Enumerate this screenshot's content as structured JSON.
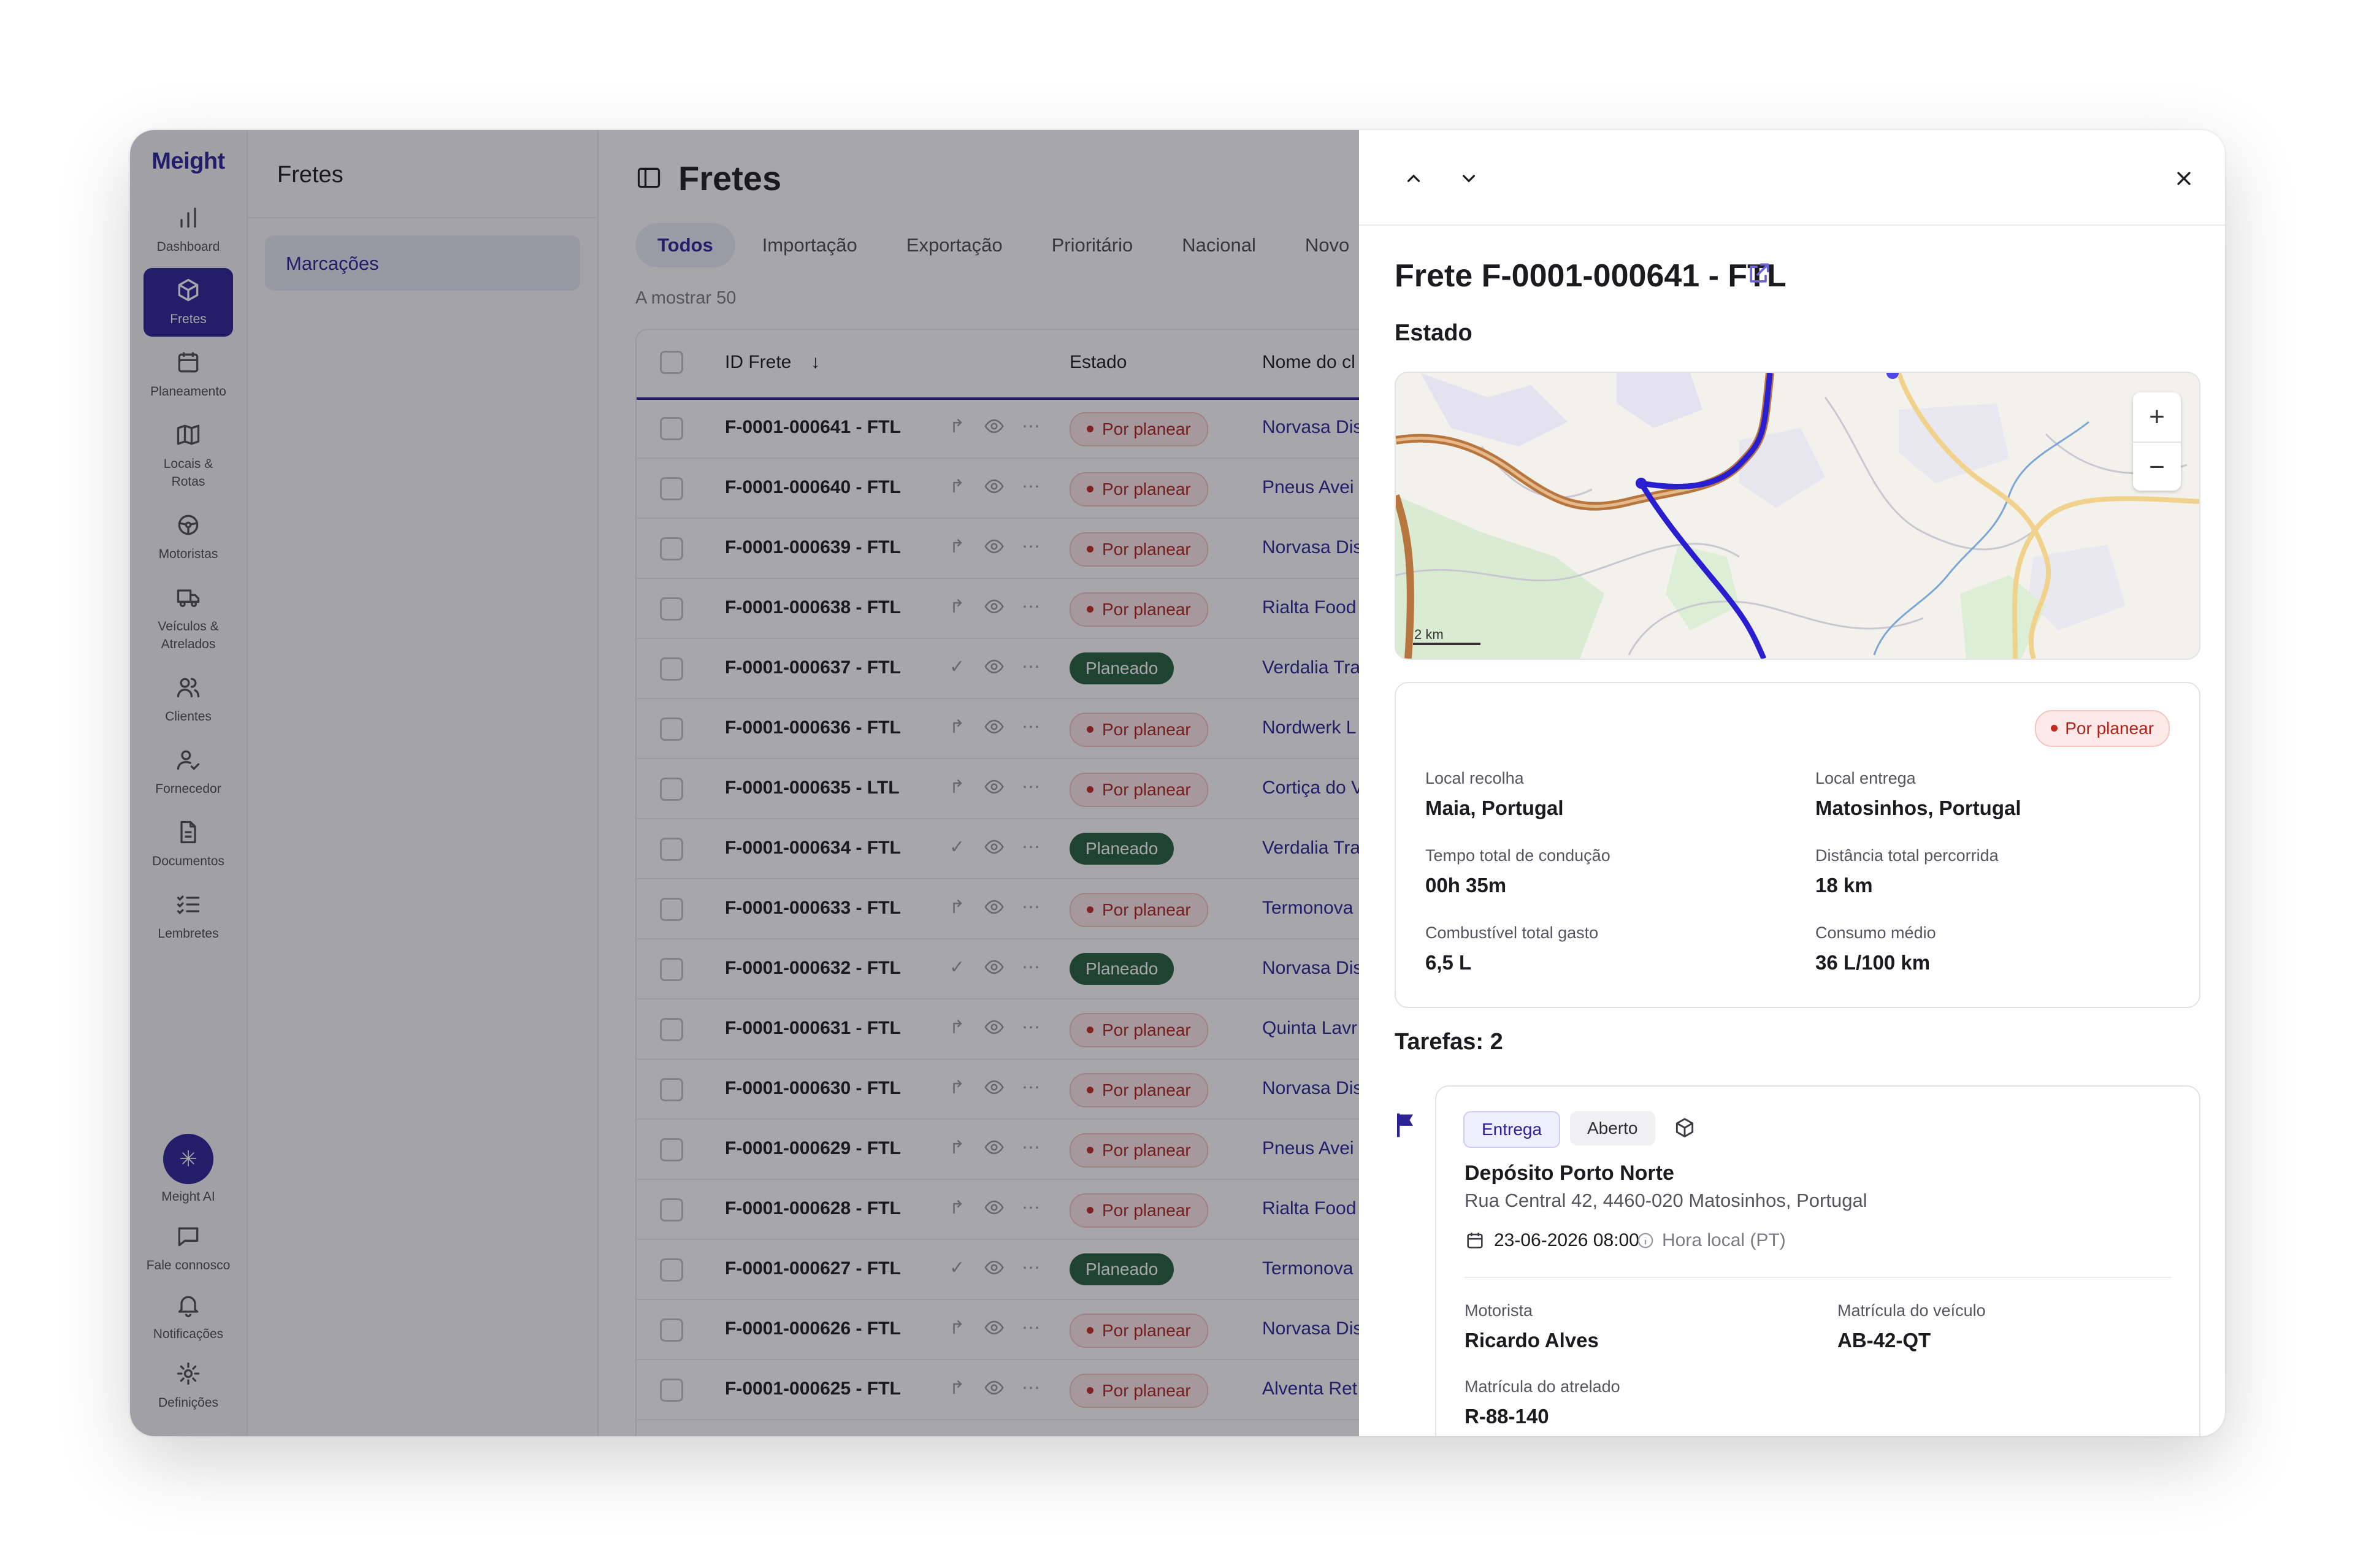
{
  "brand": "Meight",
  "nav": {
    "dashboard": "Dashboard",
    "fretes": "Fretes",
    "planeamento": "Planeamento",
    "locais": "Locais & Rotas",
    "motoristas": "Motoristas",
    "veiculos": "Veículos & Atrelados",
    "clientes": "Clientes",
    "fornecedor": "Fornecedor",
    "documentos": "Documentos",
    "lembretes": "Lembretes",
    "ai": "Meight AI",
    "contact": "Fale connosco",
    "notifications": "Notificações",
    "settings": "Definições"
  },
  "subnav": {
    "title": "Fretes",
    "item": "Marcações"
  },
  "main": {
    "title": "Fretes",
    "tabs": [
      "Todos",
      "Importação",
      "Exportação",
      "Prioritário",
      "Nacional",
      "Novo"
    ],
    "showing": "A mostrar 50",
    "col_id": "ID Frete",
    "col_status": "Estado",
    "col_client": "Nome do cl"
  },
  "rows": [
    {
      "id": "F-0001-000641 - FTL",
      "status": "Por planear",
      "state": "red",
      "client": "Norvasa Dis"
    },
    {
      "id": "F-0001-000640 - FTL",
      "status": "Por planear",
      "state": "red",
      "client": "Pneus Avei"
    },
    {
      "id": "F-0001-000639 - FTL",
      "status": "Por planear",
      "state": "red",
      "client": "Norvasa Dis"
    },
    {
      "id": "F-0001-000638 - FTL",
      "status": "Por planear",
      "state": "red",
      "client": "Rialta Food"
    },
    {
      "id": "F-0001-000637 - FTL",
      "status": "Planeado",
      "state": "green",
      "client": "Verdalia Tra"
    },
    {
      "id": "F-0001-000636 - FTL",
      "status": "Por planear",
      "state": "red",
      "client": "Nordwerk L"
    },
    {
      "id": "F-0001-000635 - LTL",
      "status": "Por planear",
      "state": "red",
      "client": "Cortiça do V"
    },
    {
      "id": "F-0001-000634 - FTL",
      "status": "Planeado",
      "state": "green",
      "client": "Verdalia Tra"
    },
    {
      "id": "F-0001-000633 - FTL",
      "status": "Por planear",
      "state": "red",
      "client": "Termonova"
    },
    {
      "id": "F-0001-000632 - FTL",
      "status": "Planeado",
      "state": "green",
      "client": "Norvasa Dis"
    },
    {
      "id": "F-0001-000631 - FTL",
      "status": "Por planear",
      "state": "red",
      "client": "Quinta Lavr"
    },
    {
      "id": "F-0001-000630 - FTL",
      "status": "Por planear",
      "state": "red",
      "client": "Norvasa Dis"
    },
    {
      "id": "F-0001-000629 - FTL",
      "status": "Por planear",
      "state": "red",
      "client": "Pneus Avei"
    },
    {
      "id": "F-0001-000628 - FTL",
      "status": "Por planear",
      "state": "red",
      "client": "Rialta Food"
    },
    {
      "id": "F-0001-000627 - FTL",
      "status": "Planeado",
      "state": "green",
      "client": "Termonova"
    },
    {
      "id": "F-0001-000626 - FTL",
      "status": "Por planear",
      "state": "red",
      "client": "Norvasa Dis"
    },
    {
      "id": "F-0001-000625 - FTL",
      "status": "Por planear",
      "state": "red",
      "client": "Alventa Ret"
    }
  ],
  "detail": {
    "title": "Frete F-0001-000641 - FTL",
    "estado_label": "Estado",
    "map_scale": "2 km",
    "status_badge": "Por planear",
    "pickup_label": "Local recolha",
    "pickup": "Maia, Portugal",
    "delivery_label": "Local entrega",
    "delivery": "Matosinhos, Portugal",
    "drive_time_label": "Tempo total de condução",
    "drive_time": "00h 35m",
    "distance_label": "Distância total percorrida",
    "distance": "18 km",
    "fuel_label": "Combustível total gasto",
    "fuel": "6,5 L",
    "consumption_label": "Consumo médio",
    "consumption": "36 L/100 km",
    "tasks_title": "Tarefas: 2",
    "task": {
      "type": "Entrega",
      "status": "Aberto",
      "name": "Depósito Porto Norte",
      "address": "Rua Central 42, 4460-020 Matosinhos, Portugal",
      "datetime": "23-06-2026 08:00",
      "local_time": "Hora local (PT)",
      "driver_label": "Motorista",
      "driver": "Ricardo Alves",
      "plate_label": "Matrícula do veículo",
      "plate": "AB-42-QT",
      "trailer_label": "Matrícula do atrelado",
      "trailer": "R-88-140"
    }
  },
  "colors": {
    "accent": "#2c2195",
    "planned": "#23603a",
    "unplanned": "#b3211b"
  }
}
